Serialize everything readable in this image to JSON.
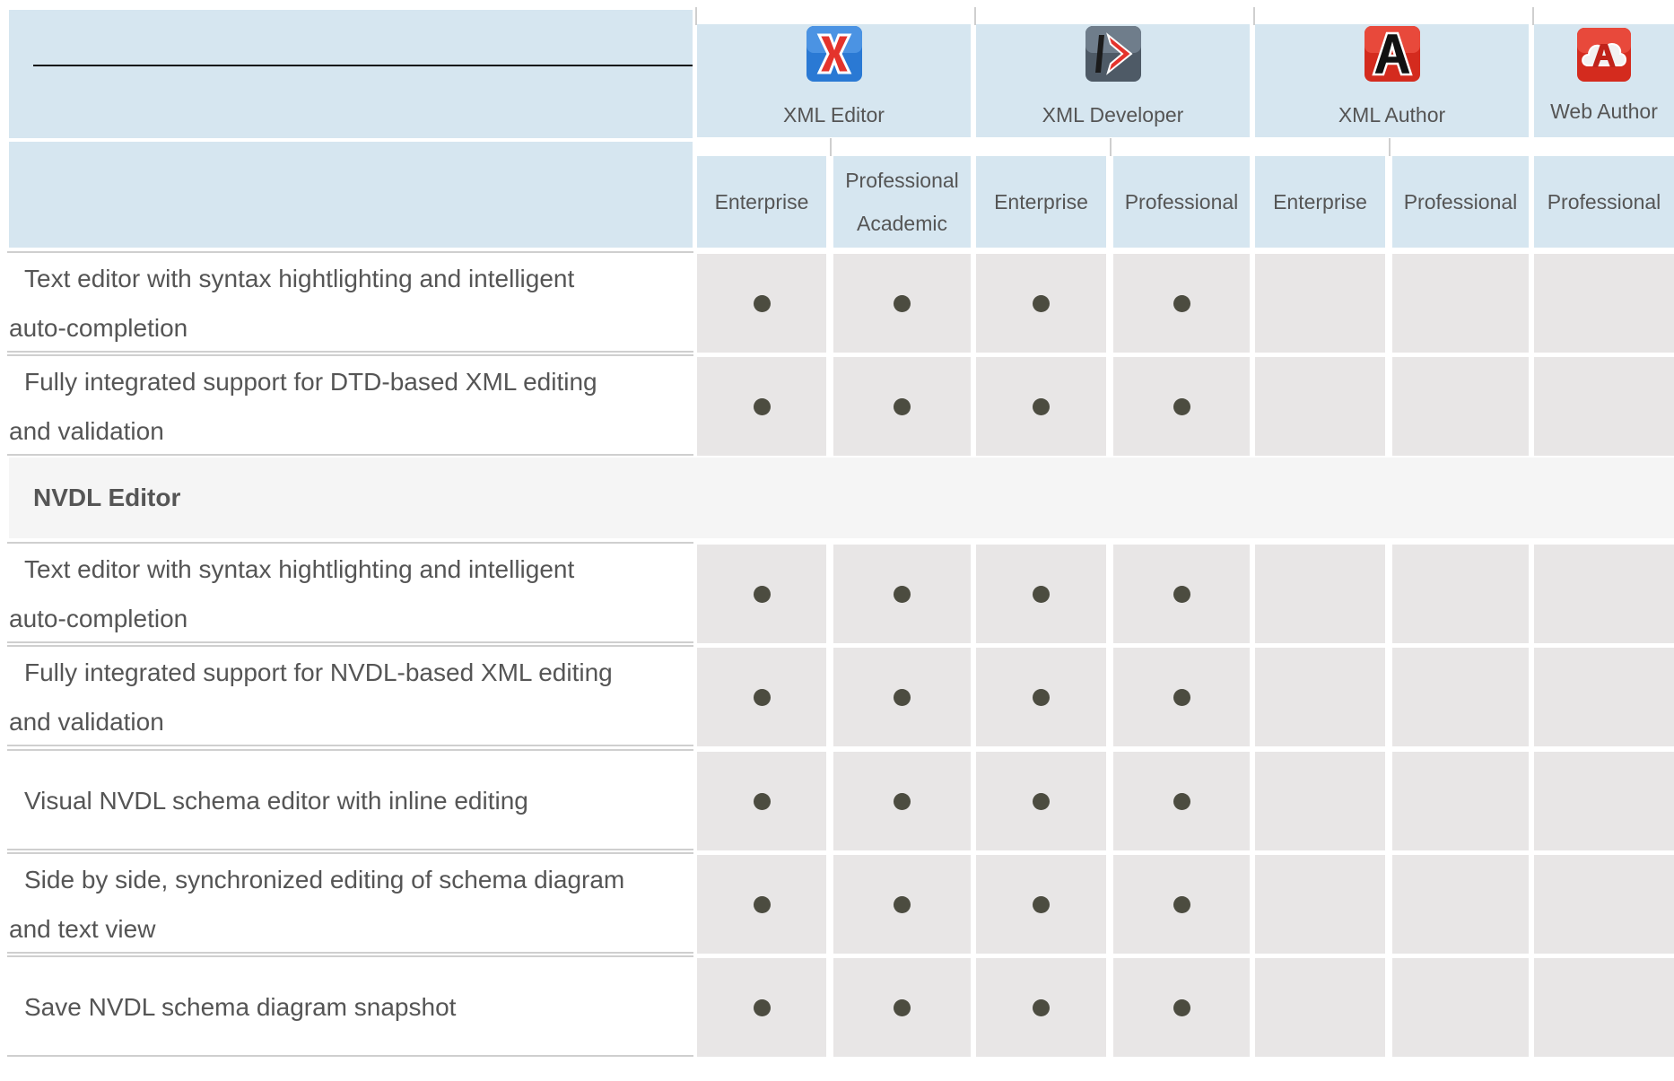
{
  "products": [
    {
      "name": "XML Editor",
      "icon": "xml-editor-icon",
      "color": "#2a79d4",
      "glyph": "X"
    },
    {
      "name": "XML Developer",
      "icon": "xml-developer-icon",
      "color": "#5b6b7c",
      "glyph": "D"
    },
    {
      "name": "XML Author",
      "icon": "xml-author-icon",
      "color": "#d42b1e",
      "glyph": "A"
    },
    {
      "name": "Web Author",
      "icon": "web-author-icon",
      "color": "#d42b1e",
      "glyph": "A"
    }
  ],
  "editions": [
    {
      "product": "XML Editor",
      "label": "Enterprise"
    },
    {
      "product": "XML Editor",
      "label_line1": "Professional",
      "label_line2": "Academic"
    },
    {
      "product": "XML Developer",
      "label": "Enterprise"
    },
    {
      "product": "XML Developer",
      "label": "Professional"
    },
    {
      "product": "XML Author",
      "label": "Enterprise"
    },
    {
      "product": "XML Author",
      "label": "Professional"
    },
    {
      "product": "Web Author",
      "label": "Professional"
    }
  ],
  "rows_group1": [
    {
      "line1": "Text editor with syntax hightlighting and intelligent",
      "line2": "auto-completion",
      "support": [
        true,
        true,
        true,
        true,
        false,
        false,
        false
      ]
    },
    {
      "line1": "Fully integrated support for DTD-based XML editing",
      "line2": "and validation",
      "support": [
        true,
        true,
        true,
        true,
        false,
        false,
        false
      ]
    }
  ],
  "section_title": "NVDL Editor",
  "rows_group2": [
    {
      "line1": "Text editor with syntax hightlighting and intelligent",
      "line2": "auto-completion",
      "support": [
        true,
        true,
        true,
        true,
        false,
        false,
        false
      ]
    },
    {
      "line1": "Fully integrated support for NVDL-based XML editing",
      "line2": "and validation",
      "support": [
        true,
        true,
        true,
        true,
        false,
        false,
        false
      ]
    },
    {
      "line1": "Visual NVDL schema editor with inline editing",
      "line2": "",
      "support": [
        true,
        true,
        true,
        true,
        false,
        false,
        false
      ]
    },
    {
      "line1": "Side by side, synchronized editing of schema diagram",
      "line2": "and text view",
      "support": [
        true,
        true,
        true,
        true,
        false,
        false,
        false
      ]
    },
    {
      "line1": "Save NVDL schema diagram snapshot",
      "line2": "",
      "support": [
        true,
        true,
        true,
        true,
        false,
        false,
        false
      ]
    }
  ]
}
